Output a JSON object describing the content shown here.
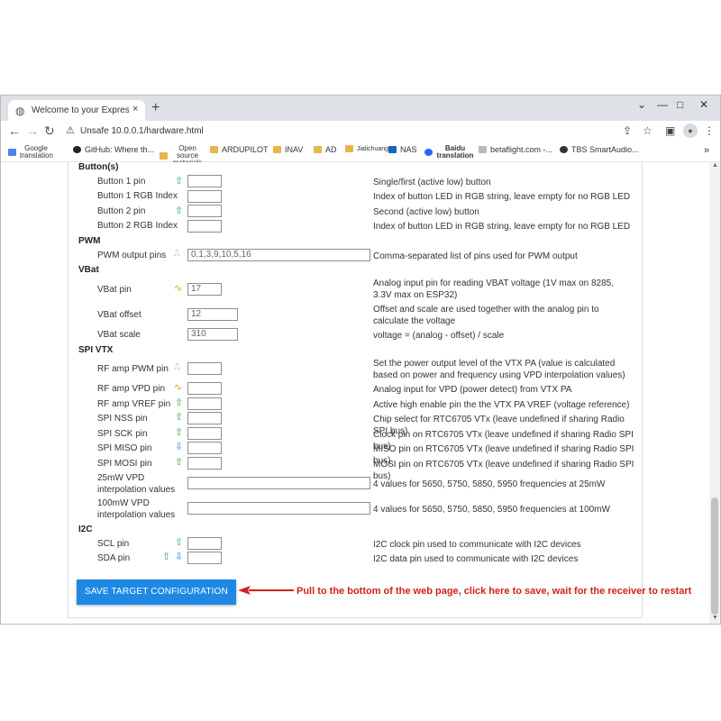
{
  "browser": {
    "tab_title": "Welcome to your ExpressLRS",
    "tab_close": "×",
    "new_tab": "+",
    "win_min": "⌄",
    "win_minimize": "—",
    "win_maximize": "□",
    "win_close": "✕",
    "url_prefix": "Unsafe",
    "url": "10.0.0.1/hardware.html",
    "bookmarks": [
      {
        "label": "Google translation"
      },
      {
        "label": "GitHub: Where th..."
      },
      {
        "label": "Open source materials"
      },
      {
        "label": "ARDUPILOT"
      },
      {
        "label": "INAV"
      },
      {
        "label": "AD"
      },
      {
        "label": "Jialichuang"
      },
      {
        "label": "NAS"
      },
      {
        "label": "Baidu translation"
      },
      {
        "label": "betaflight.com -..."
      },
      {
        "label": "TBS SmartAudio..."
      }
    ],
    "bookmarks_more": "»"
  },
  "form": {
    "button_section": "Button(s)",
    "button1_label": "Button 1 pin",
    "button1_desc": "Single/first (active low) button",
    "button1_rgb_label": "Button 1 RGB Index",
    "button1_rgb_desc": "Index of button LED in RGB string, leave empty for no RGB LED",
    "button2_label": "Button 2 pin",
    "button2_desc": "Second (active low) button",
    "button2_rgb_label": "Button 2 RGB Index",
    "button2_rgb_desc": "Index of button LED in RGB string, leave empty for no RGB LED",
    "pwm_section": "PWM",
    "pwm_label": "PWM output pins",
    "pwm_value": "0,1,3,9,10,5,16",
    "pwm_desc": "Comma-separated list of pins used for PWM output",
    "vbat_section": "VBat",
    "vbat_pin_label": "VBat pin",
    "vbat_pin_value": "17",
    "vbat_pin_desc": "Analog input pin for reading VBAT voltage (1V max on 8285, 3.3V max on ESP32)",
    "vbat_offset_label": "VBat offset",
    "vbat_offset_value": "12",
    "vbat_offset_desc": "Offset and scale are used together with the analog pin to calculate the voltage",
    "vbat_scale_label": "VBat scale",
    "vbat_scale_value": "310",
    "vbat_scale_desc": "voltage = (analog - offset) / scale",
    "spi_section": "SPI VTX",
    "rf_pwm_label": "RF amp PWM pin",
    "rf_pwm_desc": "Set the power output level of the VTX PA (value is calculated based on power and frequency using VPD interpolation values)",
    "rf_vpd_label": "RF amp VPD pin",
    "rf_vpd_desc": "Analog input for VPD (power detect) from VTX PA",
    "rf_vref_label": "RF amp VREF pin",
    "rf_vref_desc": "Active high enable pin the the VTX PA VREF (voltage reference)",
    "nss_label": "SPI NSS pin",
    "nss_desc": "Chip select for RTC6705 VTx (leave undefined if sharing Radio SPI bus)",
    "sck_label": "SPI SCK pin",
    "sck_desc": "Clock pin on RTC6705 VTx (leave undefined if sharing Radio SPI bus)",
    "miso_label": "SPI MISO pin",
    "miso_desc": "MISO pin on RTC6705 VTx (leave undefined if sharing Radio SPI bus)",
    "mosi_label": "SPI MOSI pin",
    "mosi_desc": "MOSI pin on RTC6705 VTx (leave undefined if sharing Radio SPI bus)",
    "vpd25_label": "25mW VPD interpolation values",
    "vpd25_desc": "4 values for 5650, 5750, 5850, 5950 frequencies at 25mW",
    "vpd100_label": "100mW VPD interpolation values",
    "vpd100_desc": "4 values for 5650, 5750, 5850, 5950 frequencies at 100mW",
    "i2c_section": "I2C",
    "scl_label": "SCL pin",
    "scl_desc": "I2C clock pin used to communicate with I2C devices",
    "sda_label": "SDA pin",
    "sda_desc": "I2C data pin used to communicate with I2C devices",
    "save_button": "SAVE TARGET CONFIGURATION",
    "annotation": "Pull to the bottom of the web page, click here to save, wait for the receiver to restart"
  },
  "colors": {
    "accent": "#1e88e5",
    "annotation": "#d0211c"
  }
}
